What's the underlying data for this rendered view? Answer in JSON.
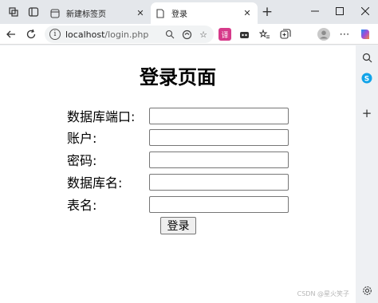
{
  "tabs": [
    {
      "title": "新建标签页"
    },
    {
      "title": "登录"
    }
  ],
  "toolbar": {
    "info_icon_glyph": "i",
    "url_host": "localhost",
    "url_path": "/login.php"
  },
  "page": {
    "heading": "登录页面",
    "fields": [
      {
        "label": "数据库端口:",
        "value": ""
      },
      {
        "label": "账户:",
        "value": ""
      },
      {
        "label": "密码:",
        "value": ""
      },
      {
        "label": "数据库名:",
        "value": ""
      },
      {
        "label": "表名:",
        "value": ""
      }
    ],
    "submit_label": "登录",
    "watermark": "CSDN @星火笑子"
  },
  "colors": {
    "page_bg": "#ffffff",
    "chrome_bg": "#e4e7eb",
    "tab_active_bg": "#ffffff"
  },
  "icons": [
    "workspaces-icon",
    "tab-actions-icon",
    "new-tab-favicon",
    "page-favicon",
    "close-icon",
    "plus-icon",
    "minimize-icon",
    "maximize-icon",
    "close-window-icon",
    "back-icon",
    "refresh-icon",
    "info-icon",
    "zoom-icon",
    "read-aloud-icon",
    "favorite-star-icon",
    "translate-extension-icon",
    "extension-icon",
    "favorites-icon",
    "collections-icon",
    "profile-avatar",
    "more-icon",
    "copilot-icon",
    "search-icon",
    "skype-icon",
    "add-icon",
    "settings-icon"
  ]
}
